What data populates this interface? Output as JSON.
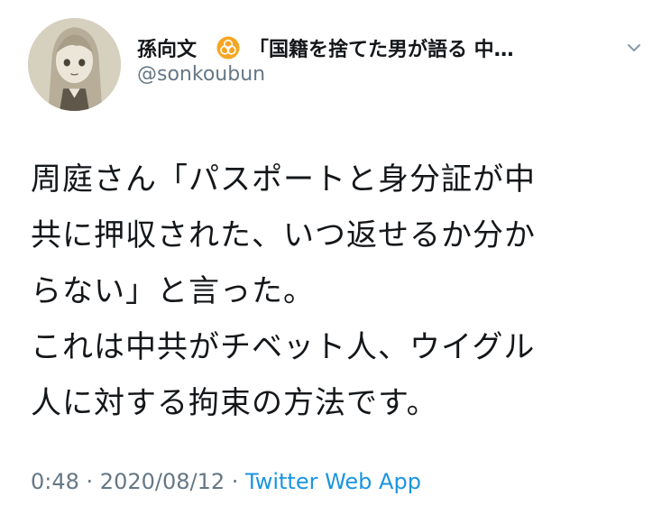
{
  "user": {
    "display_name": "孫向文",
    "name_suffix": "「国籍を捨てた男が語る 中…",
    "handle": "@sonkoubun",
    "avatar_icon": "anime-girl-avatar",
    "badge_icon": "biohazard-icon"
  },
  "tweet": {
    "lines": [
      "周庭さん「パスポートと身分証が中",
      "共に押収された、いつ返せるか分か",
      "らない」と言った。",
      "これは中共がチベット人、ウイグル",
      "人に対する拘束の方法です。"
    ]
  },
  "meta": {
    "time": "0:48",
    "separator": " · ",
    "date": "2020/08/12",
    "source": "Twitter Web App"
  },
  "colors": {
    "text": "#14171a",
    "secondary": "#657786",
    "link": "#1b95e0",
    "badge": "#f5a623"
  }
}
